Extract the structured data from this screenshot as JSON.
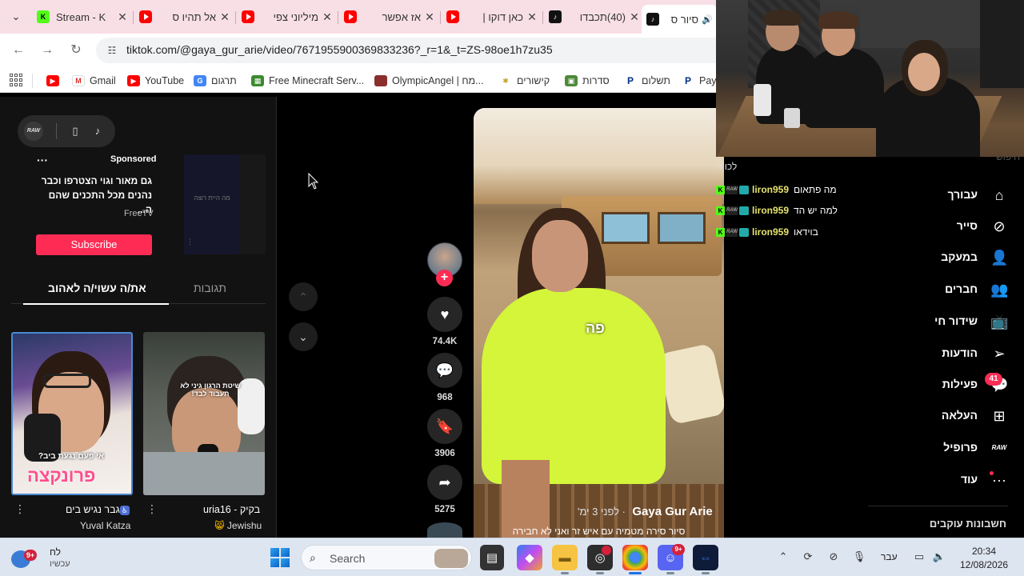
{
  "browser": {
    "tabs": [
      {
        "title": "Stream - K",
        "icon": "kick"
      },
      {
        "title": "אל תהיו ס",
        "icon": "youtube"
      },
      {
        "title": "מיליוני צפי",
        "icon": "youtube"
      },
      {
        "title": "אז אפשר ",
        "icon": "youtube"
      },
      {
        "title": "כאן דוקו |",
        "icon": "youtube"
      },
      {
        "title": "(40)תכבדו",
        "icon": "tiktok"
      },
      {
        "title": "סיור ס",
        "icon": "tiktok"
      }
    ],
    "url": "tiktok.com/@gaya_gur_arie/video/7671955900369833236?_r=1&_t=ZS-98oe1h7zu35",
    "bookmarks": [
      {
        "label": "",
        "icon": "youtube"
      },
      {
        "label": "Gmail",
        "icon": "gmail"
      },
      {
        "label": "YouTube",
        "icon": "youtube"
      },
      {
        "label": "תרגום",
        "icon": "translate"
      },
      {
        "label": "Free Minecraft Serv...",
        "icon": "minecraft"
      },
      {
        "label": "OlympicAngel | מח...",
        "icon": "avatar"
      },
      {
        "label": "קישורים",
        "icon": "star"
      },
      {
        "label": "סדרות",
        "icon": "tv"
      },
      {
        "label": "תשלום",
        "icon": "paypal"
      },
      {
        "label": "Payl",
        "icon": "paypal"
      }
    ]
  },
  "left_panel": {
    "ad": {
      "sponsored": "Sponsored",
      "text": "גם מאור וגוי הצטרפו וכבר נהנים מכל התכנים שהם ה...",
      "brand": "FreeTV",
      "subscribe": "Subscribe",
      "thumb_text": "מה היית רוצה"
    },
    "tabs": {
      "comments": "תגובות",
      "you_may_like": "את/ה עשוי/ה לאהוב"
    },
    "videos": [
      {
        "title": "גבר נגיש בים",
        "author": "Yuval Katza",
        "overlay_top": "אי פעם נגעת ביב?",
        "overlay_pink": "פרונקצה"
      },
      {
        "title": "uria16 - בקיק",
        "author": "Jewishu",
        "overlay_top": "שיטת הרגון גיני לא תעבוד לבד!"
      }
    ]
  },
  "player": {
    "likes": "74.4K",
    "comments": "968",
    "saves": "3906",
    "shares": "5275",
    "author": "Gaya Gur Arie",
    "date": "· לפני 3 ימ'",
    "caption": "סיור סירה מטמיה עם איש זר ואני לא חבירה",
    "overlay_word": "פה"
  },
  "right_nav": {
    "search_placeholder": "חיפוש",
    "items": [
      {
        "label": "עבורך",
        "icon": "home-icon"
      },
      {
        "label": "סייר",
        "icon": "compass-icon"
      },
      {
        "label": "במעקב",
        "icon": "user-plus-icon"
      },
      {
        "label": "חברים",
        "icon": "friends-icon"
      },
      {
        "label": "שידור חי",
        "icon": "live-icon"
      },
      {
        "label": "הודעות",
        "icon": "send-icon"
      },
      {
        "label": "פעילות",
        "icon": "activity-icon"
      },
      {
        "label": "העלאה",
        "icon": "upload-icon"
      },
      {
        "label": "פרופיל",
        "icon": "profile-icon"
      },
      {
        "label": "עוד",
        "icon": "more-icon"
      }
    ],
    "activity_badge": "41",
    "following_accounts": "חשבונות עוקבים"
  },
  "chat": {
    "top": "לכווה",
    "messages": [
      {
        "user": "liron959",
        "text": "מה פתאום"
      },
      {
        "user": "liron959",
        "text": "למה יש הד"
      },
      {
        "user": "liron959",
        "text": "בוידאו"
      }
    ]
  },
  "taskbar": {
    "weather_badge": "9+",
    "weather_line1": "לח",
    "weather_line2": "עכשיו",
    "search": "Search",
    "discord_badge": "9+",
    "lang": "עבר",
    "time": "20:34",
    "date": "12/08/2026"
  },
  "colors": {
    "tiktok_red": "#fe2c55",
    "kick_green": "#53fc18",
    "chat_user": "#e5e36c",
    "tab_strip": "#f8dfe6"
  }
}
